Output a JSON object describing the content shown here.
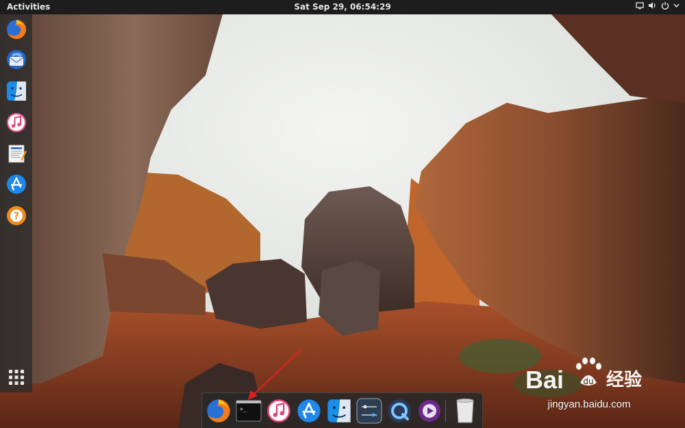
{
  "topbar": {
    "activities_label": "Activities",
    "clock": "Sat Sep 29, 06:54:29",
    "tray_icons": [
      "screen-icon",
      "volume-icon",
      "power-icon",
      "menu-chevron-icon"
    ]
  },
  "launcher": {
    "items": [
      {
        "name": "firefox",
        "icon": "firefox-icon"
      },
      {
        "name": "thunderbird",
        "icon": "thunderbird-icon"
      },
      {
        "name": "files",
        "icon": "finder-icon"
      },
      {
        "name": "music",
        "icon": "music-icon"
      },
      {
        "name": "writer",
        "icon": "document-icon"
      },
      {
        "name": "app-store",
        "icon": "appstore-icon"
      },
      {
        "name": "help",
        "icon": "help-icon"
      }
    ],
    "show_apps_icon": "app-grid-icon"
  },
  "dock": {
    "items": [
      {
        "name": "firefox",
        "icon": "firefox-icon"
      },
      {
        "name": "terminal",
        "icon": "terminal-icon"
      },
      {
        "name": "music",
        "icon": "music-icon"
      },
      {
        "name": "app-store",
        "icon": "appstore-icon"
      },
      {
        "name": "finder",
        "icon": "finder-icon"
      },
      {
        "name": "settings",
        "icon": "settings-icon"
      },
      {
        "name": "quicktime",
        "icon": "quicktime-icon"
      },
      {
        "name": "media-player",
        "icon": "media-player-icon"
      },
      {
        "name": "trash",
        "icon": "trash-icon"
      }
    ],
    "terminal_glyph": ">_"
  },
  "watermark": {
    "logo_text": "Bai du 经验",
    "url": "jingyan.baidu.com"
  },
  "colors": {
    "topbar_bg": "#1d1d1d",
    "annotation_arrow": "#e02020",
    "sky": "#eef0ee",
    "rock_orange": "#b8622e"
  }
}
